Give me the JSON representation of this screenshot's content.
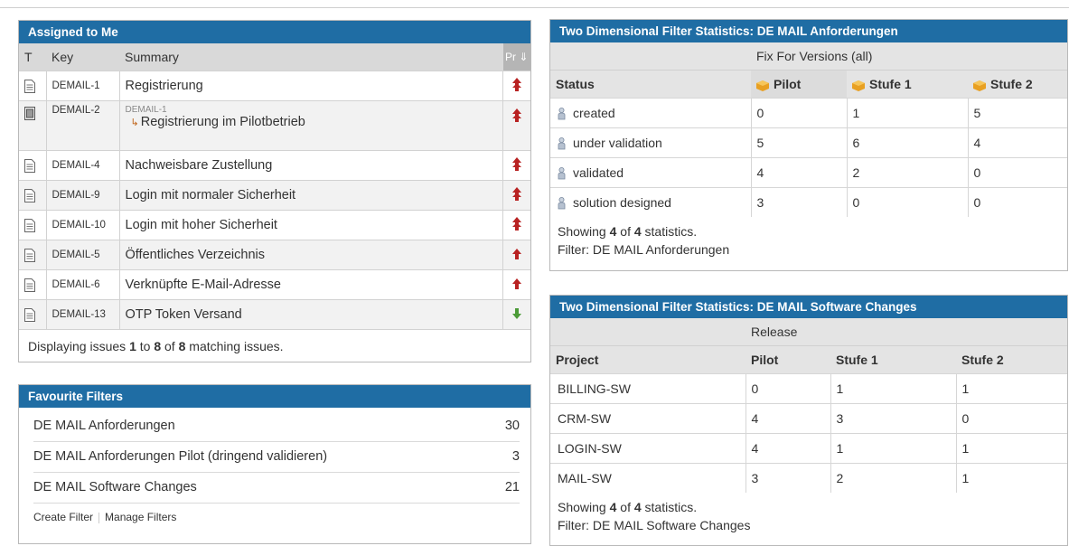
{
  "assigned": {
    "title": "Assigned to Me",
    "columns": [
      "T",
      "Key",
      "Summary",
      "Pr"
    ],
    "rows": [
      {
        "key": "DEMAIL-1",
        "summary": "Registrierung",
        "priority": "up"
      },
      {
        "key": "DEMAIL-2",
        "parent": "DEMAIL-1",
        "summary": "Registrierung im Pilotbetrieb",
        "priority": "up"
      },
      {
        "key": "DEMAIL-4",
        "summary": "Nachweisbare Zustellung",
        "priority": "up"
      },
      {
        "key": "DEMAIL-9",
        "summary": "Login mit normaler Sicherheit",
        "priority": "up"
      },
      {
        "key": "DEMAIL-10",
        "summary": "Login mit hoher Sicherheit",
        "priority": "up"
      },
      {
        "key": "DEMAIL-5",
        "summary": "Öffentliches Verzeichnis",
        "priority": "up-small"
      },
      {
        "key": "DEMAIL-6",
        "summary": "Verknüpfte E-Mail-Adresse",
        "priority": "up-small"
      },
      {
        "key": "DEMAIL-13",
        "summary": "OTP Token Versand",
        "priority": "down"
      }
    ],
    "footer_prefix": "Displaying issues ",
    "footer_from": "1",
    "footer_to_word": " to ",
    "footer_to": "8",
    "footer_of_word": " of ",
    "footer_total": "8",
    "footer_suffix": " matching issues."
  },
  "favourites": {
    "title": "Favourite Filters",
    "items": [
      {
        "label": "DE MAIL Anforderungen",
        "count": "30"
      },
      {
        "label": "DE MAIL Anforderungen Pilot (dringend validieren)",
        "count": "3"
      },
      {
        "label": "DE MAIL Software Changes",
        "count": "21"
      }
    ],
    "create_link": "Create Filter",
    "manage_link": "Manage Filters"
  },
  "stats1": {
    "title": "Two Dimensional Filter Statistics: DE MAIL Anforderungen",
    "group_label": "Fix For Versions (all)",
    "row_header": "Status",
    "columns": [
      "Pilot",
      "Stufe 1",
      "Stufe 2"
    ],
    "rows": [
      {
        "label": "created",
        "values": [
          "0",
          "1",
          "5"
        ]
      },
      {
        "label": "under validation",
        "values": [
          "5",
          "6",
          "4"
        ]
      },
      {
        "label": "validated",
        "values": [
          "4",
          "2",
          "0"
        ]
      },
      {
        "label": "solution designed",
        "values": [
          "3",
          "0",
          "0"
        ]
      }
    ],
    "showing_prefix": "Showing ",
    "showing_n": "4",
    "showing_of": " of ",
    "showing_total": "4",
    "showing_suffix": " statistics.",
    "filter_line": "Filter: DE MAIL Anforderungen"
  },
  "stats2": {
    "title": "Two Dimensional Filter Statistics: DE MAIL Software Changes",
    "group_label": "Release",
    "row_header": "Project",
    "columns": [
      "Pilot",
      "Stufe 1",
      "Stufe 2"
    ],
    "rows": [
      {
        "label": "BILLING-SW",
        "values": [
          "0",
          "1",
          "1"
        ]
      },
      {
        "label": "CRM-SW",
        "values": [
          "4",
          "3",
          "0"
        ]
      },
      {
        "label": "LOGIN-SW",
        "values": [
          "4",
          "1",
          "1"
        ]
      },
      {
        "label": "MAIL-SW",
        "values": [
          "3",
          "2",
          "1"
        ]
      }
    ],
    "showing_prefix": "Showing ",
    "showing_n": "4",
    "showing_of": " of ",
    "showing_total": "4",
    "showing_suffix": " statistics.",
    "filter_line": "Filter: DE MAIL Software Changes"
  },
  "colors": {
    "header_blue": "#1f6da4",
    "priority_up": "#b82222",
    "priority_down": "#4c9b38"
  }
}
